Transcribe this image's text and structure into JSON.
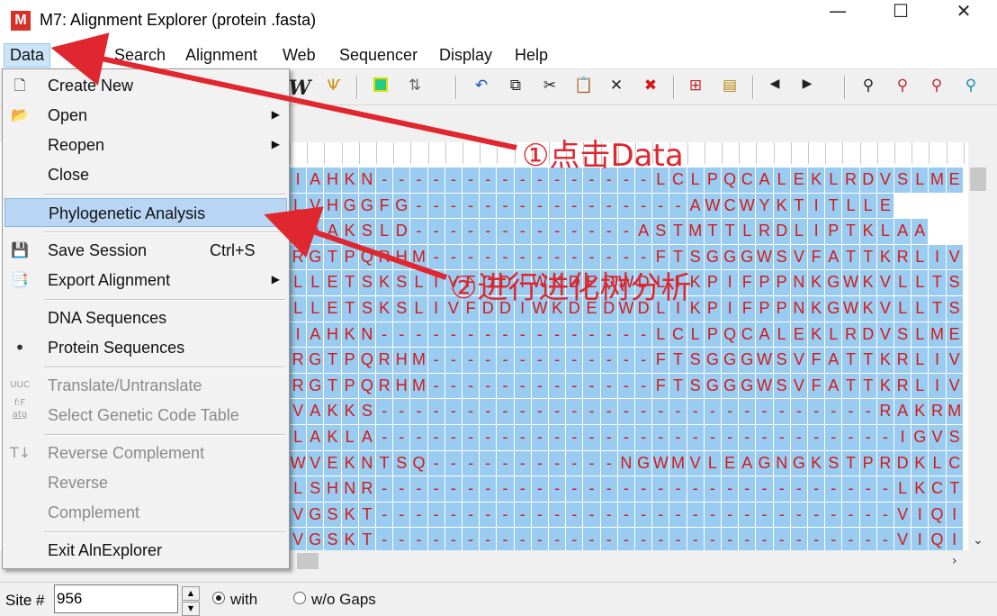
{
  "window": {
    "title": "M7: Alignment Explorer (protein .fasta)",
    "app_icon": "M",
    "minimize": "—",
    "maximize": "☐",
    "close": "✕"
  },
  "menubar": [
    {
      "label": "Data"
    },
    {
      "label": "Edit"
    },
    {
      "label": "Search"
    },
    {
      "label": "Alignment"
    },
    {
      "label": "Web"
    },
    {
      "label": "Sequencer"
    },
    {
      "label": "Display"
    },
    {
      "label": "Help"
    }
  ],
  "toolbar": {
    "icons": [
      "w-icon",
      "clamp-icon",
      "square-icon",
      "transfer-icon",
      "undo-icon",
      "copy-icon",
      "cut-icon",
      "paste-icon",
      "delete-icon",
      "delete-gap-icon",
      "insert-icon",
      "paste-block-icon",
      "prev-icon",
      "next-icon",
      "find-icon",
      "find-prev-icon",
      "find-next-icon",
      "find-motif-icon"
    ]
  },
  "data_menu": {
    "items": [
      {
        "label": "Create New",
        "icon": "new-file-icon",
        "enabled": true
      },
      {
        "label": "Open",
        "icon": "open-folder-icon",
        "enabled": true,
        "submenu": true
      },
      {
        "label": "Reopen",
        "enabled": true,
        "submenu": true
      },
      {
        "label": "Close",
        "enabled": true
      },
      {
        "label": "Phylogenetic Analysis",
        "enabled": true,
        "highlighted": true
      },
      {
        "label": "Save Session",
        "icon": "save-icon",
        "shortcut": "Ctrl+S",
        "enabled": true
      },
      {
        "label": "Export Alignment",
        "icon": "export-icon",
        "enabled": true,
        "submenu": true
      },
      {
        "label": "DNA Sequences",
        "enabled": true
      },
      {
        "label": "Protein Sequences",
        "enabled": true,
        "checked": true
      },
      {
        "label": "Translate/Untranslate",
        "icon": "translate-icon",
        "enabled": false
      },
      {
        "label": "Select Genetic Code Table",
        "icon": "genetic-code-icon",
        "enabled": false
      },
      {
        "label": "Reverse Complement",
        "icon": "reverse-complement-icon",
        "enabled": false
      },
      {
        "label": "Reverse",
        "enabled": false
      },
      {
        "label": "Complement",
        "enabled": false
      },
      {
        "label": "Exit AlnExplorer",
        "enabled": true
      }
    ]
  },
  "sequences": [
    "IAHKN----------------LCLPQCALEKLRDVSLME",
    "LVHGGFG----------------AWCWYKTITLLE",
    "RAAKSLD-------------ASTMTTLRDLIPTKLAA",
    "RGTPQRHM-------------FTSGGGWSVFATTKRLIV",
    "LLETSKSLIVFDDIWKDEDWDLIKPIFPPNKGWKVLLTS",
    "LLETSKSLIVFDDIWKDEDWDLIKPIFPPNKGWKVLLTS",
    "IAHKN----------------LCLPQCALEKLRDVSLME",
    "RGTPQRHM-------------FTSGGGWSVFATTKRLIV",
    "RGTPQRHM-------------FTSGGGWSVFATTKRLIV",
    "VAKKS-----------------------------RAKRMII",
    "LAKLA------------------------------IGVSLSR",
    "WVEKNTSQ-----------NGWMVLEAGNGKSTPRDKLCL",
    "LSHNR------------------------------LKCTIPFEI",
    "VGSKT------------------------------VIQIRSHA",
    "VGSKT------------------------------VIQIRSHA"
  ],
  "status": {
    "site_label": "Site #",
    "site_value": "956",
    "with_label": "with",
    "without_label": "w/o Gaps"
  },
  "annotations": {
    "step1": "①点击Data",
    "step2": "②进行进化树分析"
  },
  "colors": {
    "cell_bg": "#99ccf0",
    "residue": "#d21a1a",
    "annotation": "#e0272f",
    "highlight": "#b8d6f4"
  }
}
